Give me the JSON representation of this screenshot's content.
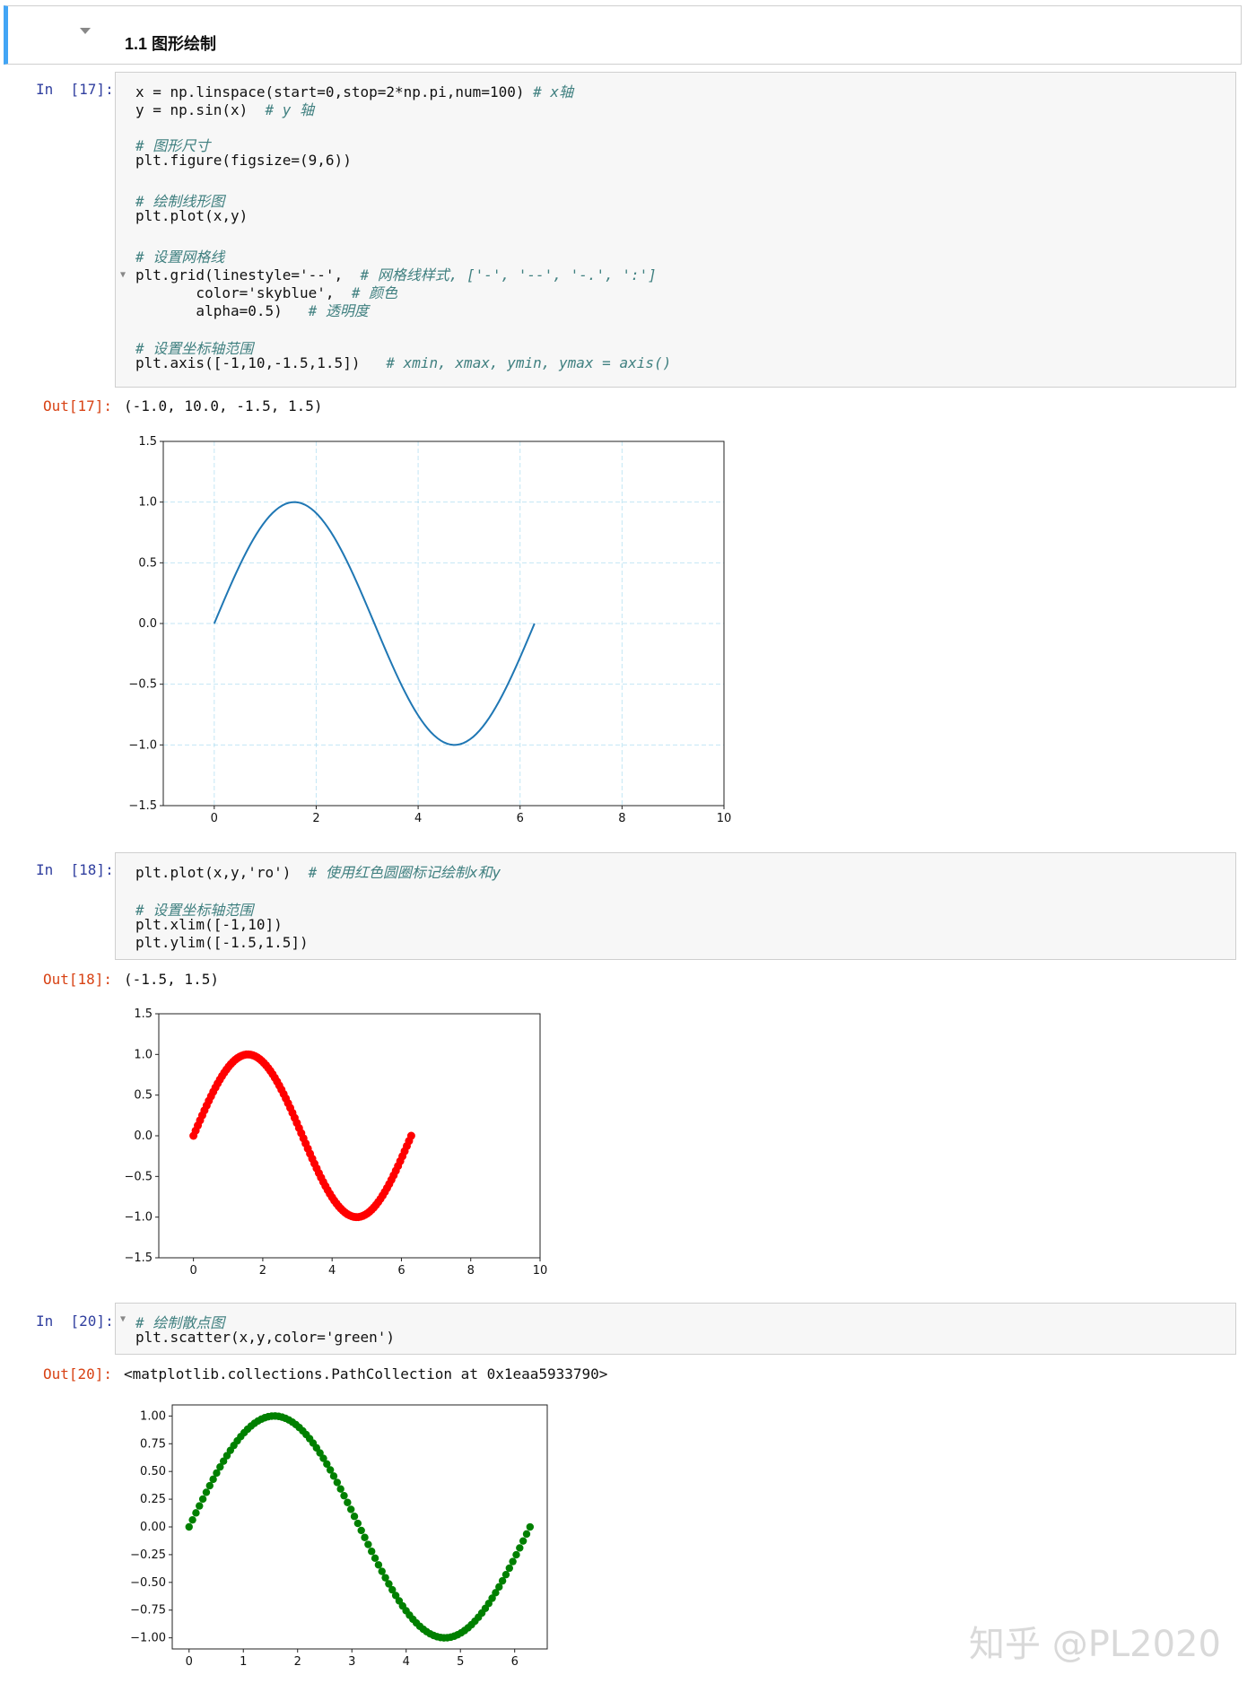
{
  "heading": "1.1 图形绘制",
  "cells": [
    {
      "in_prompt": "In  [17]:",
      "out_prompt": "Out[17]:",
      "output_text": "(-1.0, 10.0, -1.5, 1.5)",
      "lines": [
        {
          "code": "x = np.linspace(start=0,stop=2*np.pi,num=100) ",
          "comment": "# x轴"
        },
        {
          "code": "y = np.sin(x)  ",
          "comment": "# y 轴"
        },
        {
          "code": "",
          "comment": ""
        },
        {
          "code": "",
          "comment": "# 图形尺寸"
        },
        {
          "code": "plt.figure(figsize=(9,6))",
          "comment": ""
        },
        {
          "code": "",
          "comment": ""
        },
        {
          "code": "",
          "comment": "# 绘制线形图"
        },
        {
          "code": "plt.plot(x,y)",
          "comment": ""
        },
        {
          "code": "",
          "comment": ""
        },
        {
          "code": "",
          "comment": "# 设置网格线"
        },
        {
          "code": "plt.grid(linestyle='--',  ",
          "comment": "# 网格线样式, ['-', '--', '-.', ':']"
        },
        {
          "code": "       color='skyblue',  ",
          "comment": "# 颜色"
        },
        {
          "code": "       alpha=0.5)   ",
          "comment": "# 透明度"
        },
        {
          "code": "",
          "comment": ""
        },
        {
          "code": "",
          "comment": "# 设置坐标轴范围"
        },
        {
          "code": "plt.axis([-1,10,-1.5,1.5])   ",
          "comment": "# xmin, xmax, ymin, ymax = axis()"
        }
      ]
    },
    {
      "in_prompt": "In  [18]:",
      "out_prompt": "Out[18]:",
      "output_text": "(-1.5, 1.5)",
      "lines": [
        {
          "code": "plt.plot(x,y,'ro')  ",
          "comment": "# 使用红色圆圈标记绘制x和y"
        },
        {
          "code": "",
          "comment": ""
        },
        {
          "code": "",
          "comment": "# 设置坐标轴范围"
        },
        {
          "code": "plt.xlim([-1,10])",
          "comment": ""
        },
        {
          "code": "plt.ylim([-1.5,1.5])",
          "comment": ""
        }
      ]
    },
    {
      "in_prompt": "In  [20]:",
      "out_prompt": "Out[20]:",
      "output_text": "<matplotlib.collections.PathCollection at 0x1eaa5933790>",
      "lines": [
        {
          "code": "",
          "comment": "# 绘制散点图"
        },
        {
          "code": "plt.scatter(x,y,color='green')",
          "comment": ""
        }
      ]
    }
  ],
  "chart_data": [
    {
      "type": "line",
      "function": "y = sin(x), x = linspace(0, 2π, 100)",
      "n_points": 100,
      "x_start": 0,
      "x_end": 6.283,
      "xlim": [
        -1,
        10
      ],
      "ylim": [
        -1.5,
        1.5
      ],
      "xticks": [
        "0",
        "2",
        "4",
        "6",
        "8",
        "10"
      ],
      "yticks": [
        "1.5",
        "1.0",
        "0.5",
        "0.0",
        "−0.5",
        "−1.0",
        "−1.5"
      ],
      "grid": true,
      "grid_style": "dashed",
      "color": "#1f77b4",
      "grid_color": "#87ceeb"
    },
    {
      "type": "scatter",
      "marker": "ro",
      "function": "y = sin(x), x = linspace(0, 2π, 100)",
      "n_points": 100,
      "x_start": 0,
      "x_end": 6.283,
      "xlim": [
        -1,
        10
      ],
      "ylim": [
        -1.5,
        1.5
      ],
      "xticks": [
        "0",
        "2",
        "4",
        "6",
        "8",
        "10"
      ],
      "yticks": [
        "1.5",
        "1.0",
        "0.5",
        "0.0",
        "−0.5",
        "−1.0",
        "−1.5"
      ],
      "grid": false,
      "color": "#ff0000"
    },
    {
      "type": "scatter",
      "function": "y = sin(x), x = linspace(0, 2π, 100)",
      "n_points": 100,
      "x_start": 0,
      "x_end": 6.283,
      "xlim": [
        -0.31,
        6.6
      ],
      "ylim": [
        -1.1,
        1.1
      ],
      "xticks": [
        "0",
        "1",
        "2",
        "3",
        "4",
        "5",
        "6"
      ],
      "yticks": [
        "1.00",
        "0.75",
        "0.50",
        "0.25",
        "0.00",
        "−0.25",
        "−0.50",
        "−0.75",
        "−1.00"
      ],
      "grid": false,
      "color": "#008000"
    }
  ],
  "watermark": "知乎 @PL2020"
}
